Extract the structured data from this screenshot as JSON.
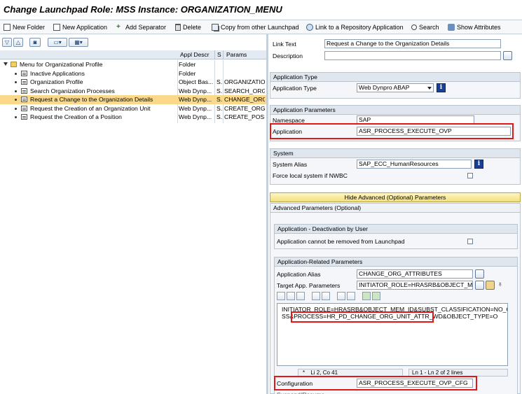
{
  "window": {
    "title": "Change Launchpad Role: MSS Instance: ORGANIZATION_MENU"
  },
  "toolbar": {
    "new_folder": "New Folder",
    "new_application": "New Application",
    "add_separator": "Add Separator",
    "delete": "Delete",
    "copy_from_other": "Copy from other Launchpad",
    "link_repository": "Link to a Repository Application",
    "search": "Search",
    "show_attributes": "Show Attributes"
  },
  "tree": {
    "columns": [
      "",
      "Appl Descr",
      "S",
      "Params"
    ],
    "rows": [
      {
        "label": "Menu for Organizational Profile",
        "descr": "Folder",
        "s": "",
        "params": "",
        "icon": "folder-open-icon",
        "level": 0
      },
      {
        "label": "Inactive Applications",
        "descr": "Folder",
        "s": "",
        "params": "",
        "icon": "list-icon",
        "level": 1
      },
      {
        "label": "Organization Profile",
        "descr": "Object Bas...",
        "s": "S...",
        "params": "ORGANIZATIO",
        "icon": "document-icon",
        "level": 1
      },
      {
        "label": "Search Organization Processes",
        "descr": "Web Dynp...",
        "s": "S...",
        "params": "SEARCH_ORG",
        "icon": "document-icon",
        "level": 1
      },
      {
        "label": "Request a Change to the Organization Details",
        "descr": "Web Dynp...",
        "s": "S...",
        "params": "CHANGE_ORG",
        "icon": "document-icon",
        "level": 1,
        "selected": true
      },
      {
        "label": "Request the Creation of an Organization Unit",
        "descr": "Web Dynp...",
        "s": "S...",
        "params": "CREATE_ORG",
        "icon": "document-icon",
        "level": 1
      },
      {
        "label": "Request the Creation of a Position",
        "descr": "Web Dynp...",
        "s": "S...",
        "params": "CREATE_POSI",
        "icon": "document-icon",
        "level": 1
      }
    ]
  },
  "details": {
    "link_text_label": "Link Text",
    "link_text_value": "Request a Change to the Organization Details",
    "description_label": "Description",
    "app_type_header": "Application Type",
    "app_type_label": "Application Type",
    "app_type_value": "Web Dynpro ABAP",
    "app_params_header": "Application Parameters",
    "namespace_label": "Namespace",
    "namespace_value": "SAP",
    "application_label": "Application",
    "application_value": "ASR_PROCESS_EXECUTE_OVP",
    "system_header": "System",
    "system_alias_label": "System Alias",
    "system_alias_value": "SAP_ECC_HumanResources",
    "force_local_label": "Force local system if NWBC",
    "hide_advanced_button": "Hide Advanced (Optional) Parameters",
    "advanced_header": "Advanced Parameters (Optional)",
    "deactivation_header": "Application - Deactivation by User",
    "cannot_remove_label": "Application cannot be removed from Launchpad",
    "related_header": "Application-Related Parameters",
    "alias_label": "Application Alias",
    "alias_value": "CHANGE_ORG_ATTRIBUTES",
    "target_params_label": "Target App. Parameters",
    "target_params_value": "INITIATOR_ROLE=HRASRB&OBJECT_ME...",
    "params_text_line1": "INITIATOR_ROLE=HRASRB&OBJECT_MEM_ID&SUBST_CLASSIFICATION=NO_CLA",
    "params_text_line2": "SS&PROCESS=HR_PD_CHANGE_ORG_UNIT_ATTR_WD&OBJECT_TYPE=O",
    "status_cursor": "Li 2, Co 41",
    "status_lines": "Ln 1 - Ln 2 of 2 lines",
    "configuration_label": "Configuration",
    "configuration_value": "ASR_PROCESS_EXECUTE_OVP_CFG",
    "cut_label": "Suspend/Resume"
  },
  "colors": {
    "highlight_red": "#e21818",
    "selection": "#fbd98a",
    "section_header": "#dfe6ee"
  }
}
